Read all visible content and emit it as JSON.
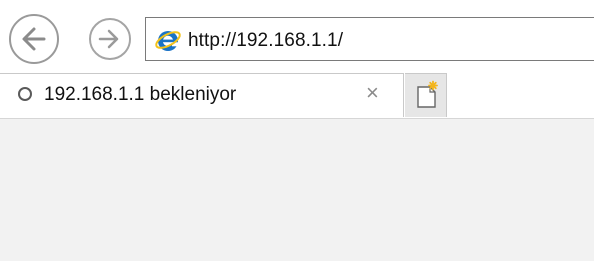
{
  "navigation": {
    "back_icon": "back-arrow-icon",
    "forward_icon": "forward-arrow-icon"
  },
  "address_bar": {
    "browser_icon": "internet-explorer-icon",
    "url": "http://192.168.1.1/"
  },
  "tab": {
    "status_icon": "loading-spinner-icon",
    "title": "192.168.1.1 bekleniyor",
    "close_label": "×"
  },
  "new_tab": {
    "icon": "new-tab-icon"
  },
  "colors": {
    "ie_blue": "#1a73c6",
    "ie_ring": "#f2c21b",
    "content_background": "#f2f2f2"
  }
}
